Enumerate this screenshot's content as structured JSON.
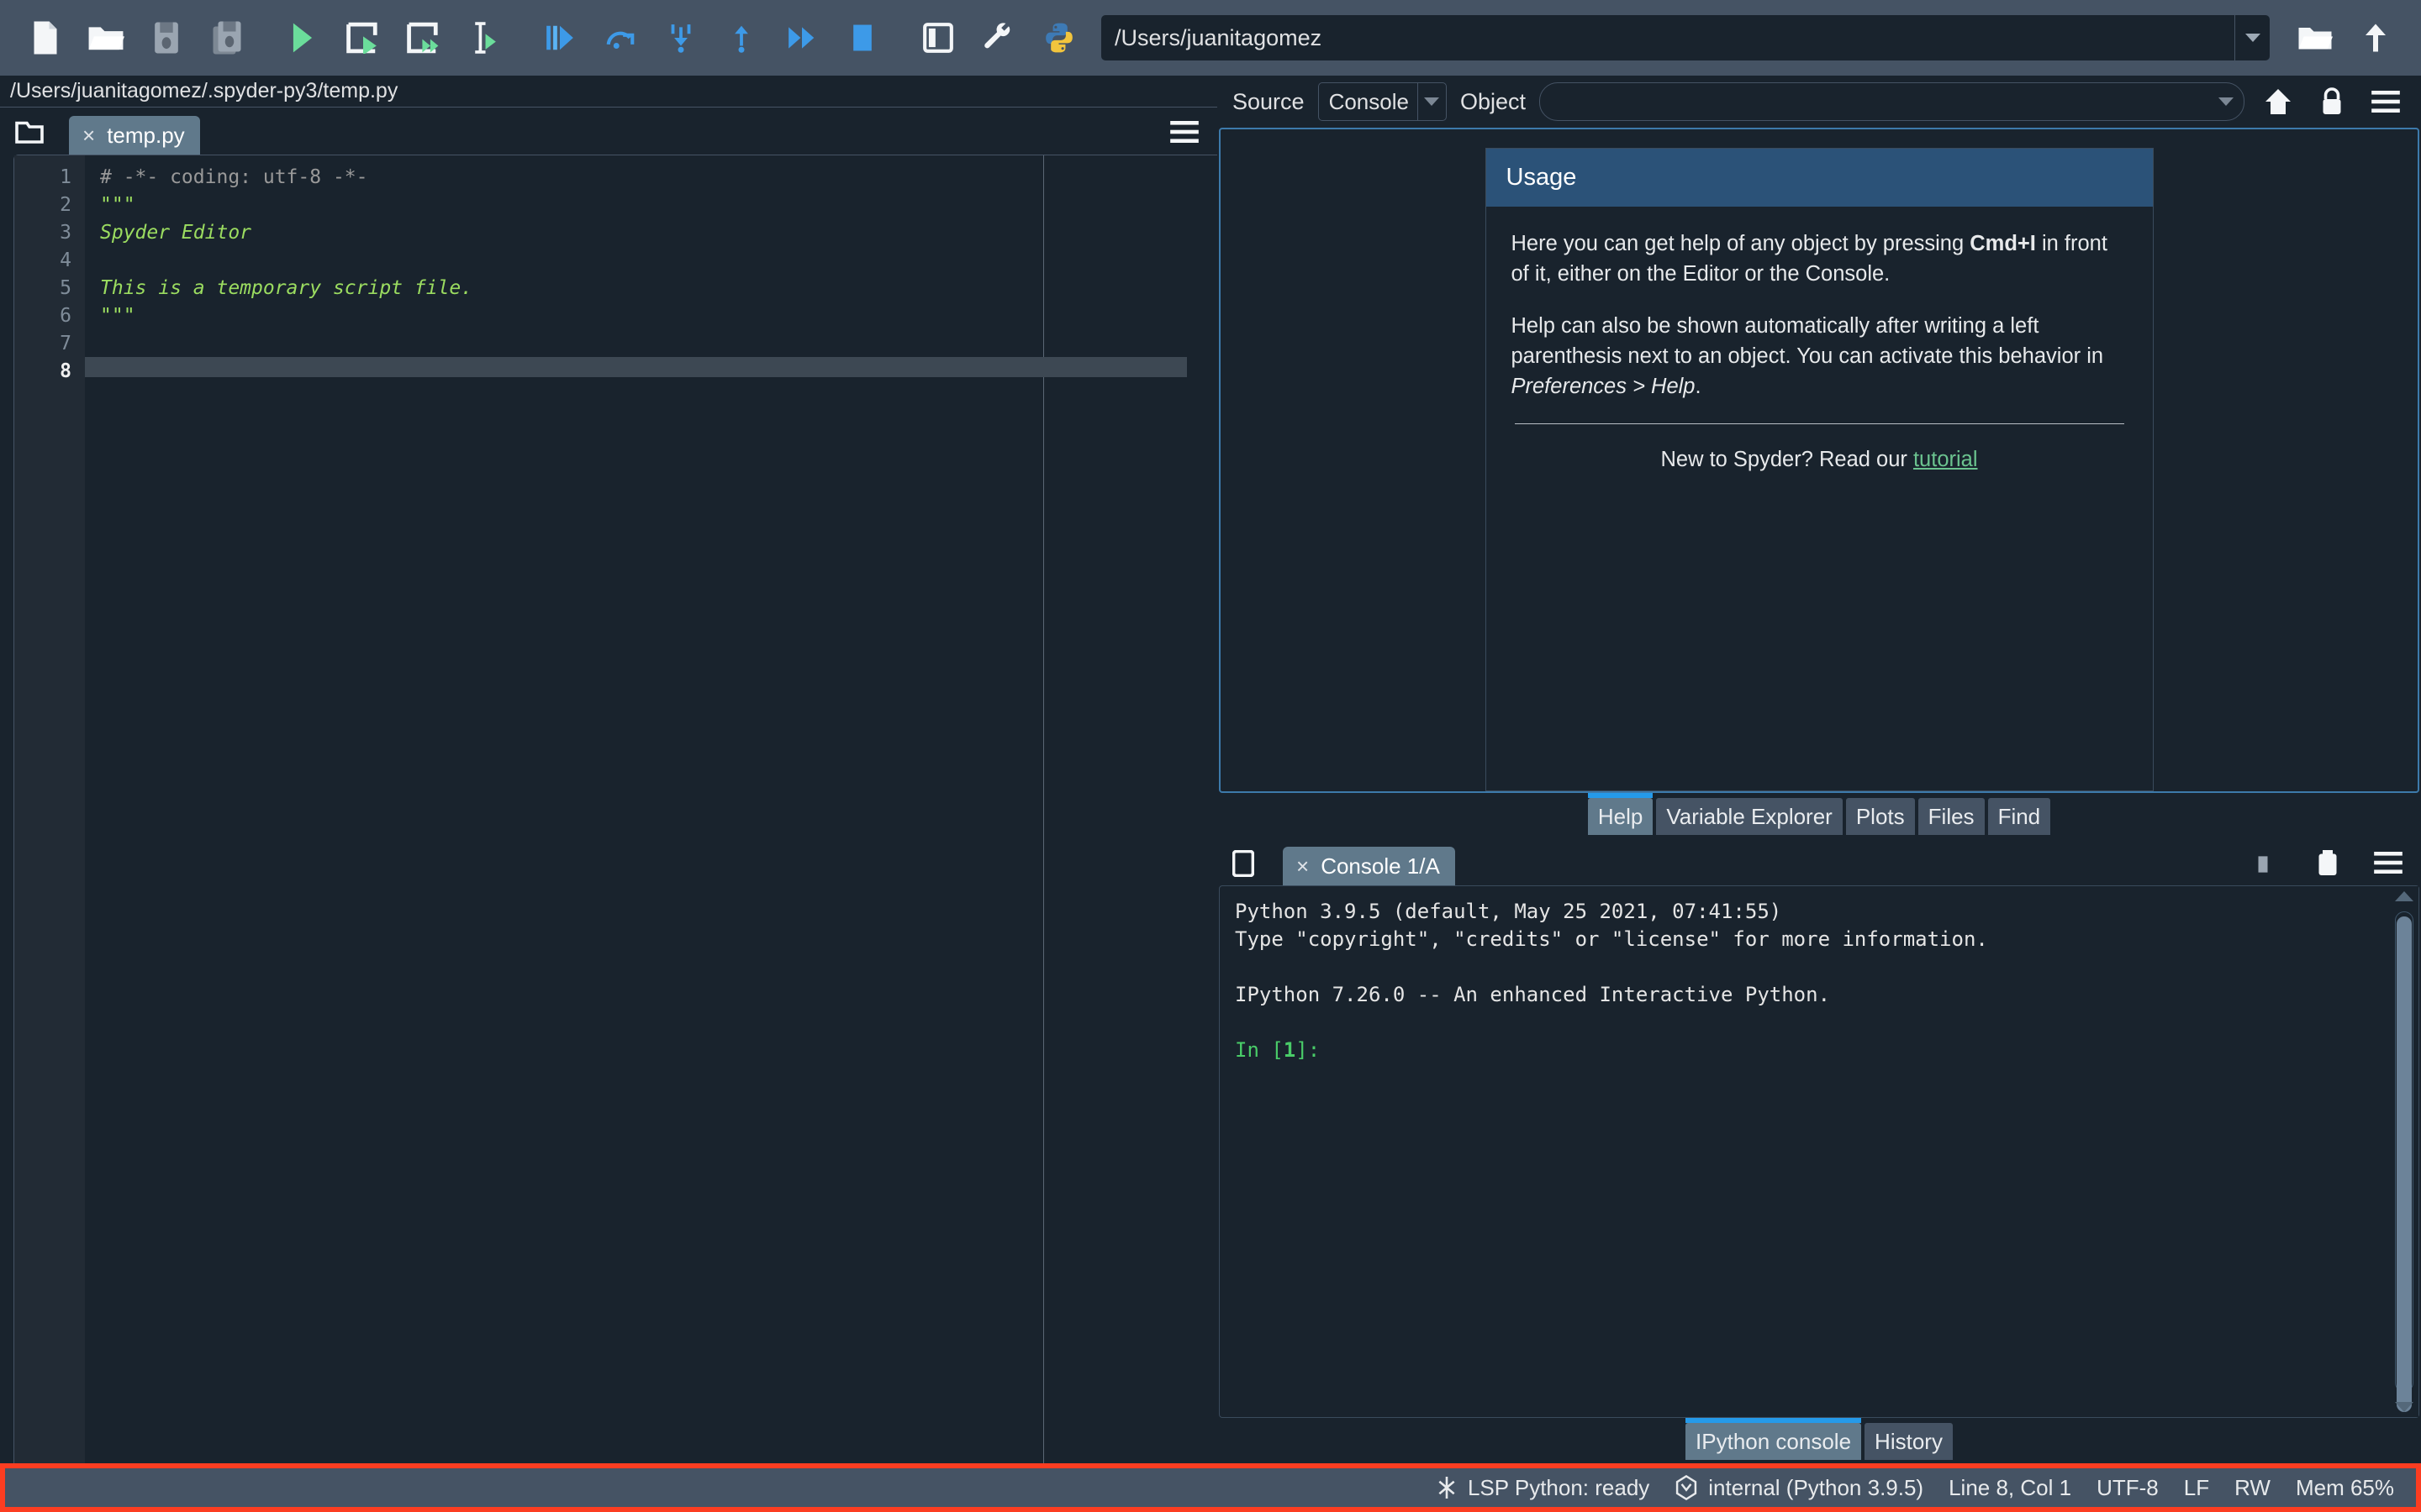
{
  "toolbar": {
    "buttons": [
      {
        "name": "new-file",
        "icon": "new-file-icon"
      },
      {
        "name": "open-file",
        "icon": "open-folder-icon"
      },
      {
        "name": "save-file",
        "icon": "save-icon"
      },
      {
        "name": "save-all",
        "icon": "save-all-icon"
      },
      {
        "name": "run-file",
        "icon": "run-icon"
      },
      {
        "name": "run-cell",
        "icon": "run-cell-icon"
      },
      {
        "name": "run-cell-advance",
        "icon": "run-cell-advance-icon"
      },
      {
        "name": "run-selection",
        "icon": "run-selection-icon"
      },
      {
        "name": "debug-file",
        "icon": "debug-icon"
      },
      {
        "name": "step-over",
        "icon": "step-over-icon"
      },
      {
        "name": "step-into",
        "icon": "step-into-icon"
      },
      {
        "name": "step-return",
        "icon": "step-return-icon"
      },
      {
        "name": "continue-execution",
        "icon": "continue-icon"
      },
      {
        "name": "stop-debugging",
        "icon": "stop-icon"
      },
      {
        "name": "maximize-pane",
        "icon": "maximize-pane-icon"
      },
      {
        "name": "preferences",
        "icon": "wrench-icon"
      },
      {
        "name": "python-path-manager",
        "icon": "python-icon"
      }
    ],
    "working_directory": "/Users/juanitagomez",
    "browse_label": "browse-folder-icon",
    "parent_label": "parent-directory-icon"
  },
  "editor": {
    "file_path": "/Users/juanitagomez/.spyder-py3/temp.py",
    "tab_label": "temp.py",
    "close_label": "×",
    "line_numbers": [
      "1",
      "2",
      "3",
      "4",
      "5",
      "6",
      "7",
      "8"
    ],
    "current_line": 8,
    "code": {
      "l1": "# -*- coding: utf-8 -*-",
      "l2": "\"\"\"",
      "l3": "Spyder Editor",
      "l4": "",
      "l5": "This is a temporary script file.",
      "l6": "\"\"\"",
      "l7": "",
      "l8": ""
    }
  },
  "help": {
    "source_label": "Source",
    "source_value": "Console",
    "object_label": "Object",
    "object_value": "",
    "home_icon": "home-icon",
    "lock_icon": "lock-icon",
    "options_icon": "hamburger-menu-icon",
    "card": {
      "title": "Usage",
      "paragraph1_pre": "Here you can get help of any object by pressing ",
      "paragraph1_kbd": "Cmd+I",
      "paragraph1_post": " in front of it, either on the Editor or the Console.",
      "paragraph2_pre": "Help can also be shown automatically after writing a left parenthesis next to an object. You can activate this behavior in ",
      "paragraph2_em": "Preferences > Help",
      "paragraph2_post": ".",
      "footer_pre": "New to Spyder? Read our ",
      "footer_link": "tutorial"
    },
    "tabs": [
      {
        "label": "Help",
        "active": true
      },
      {
        "label": "Variable Explorer",
        "active": false
      },
      {
        "label": "Plots",
        "active": false
      },
      {
        "label": "Files",
        "active": false
      },
      {
        "label": "Find",
        "active": false
      }
    ]
  },
  "console": {
    "tab_label": "Console 1/A",
    "close_label": "×",
    "browse_icon": "browse-tabs-icon",
    "interrupt_icon": "stop-square-icon",
    "remove_icon": "trash-icon",
    "options_icon": "hamburger-menu-icon",
    "output": {
      "line1": "Python 3.9.5 (default, May 25 2021, 07:41:55)",
      "line2": "Type \"copyright\", \"credits\" or \"license\" for more information.",
      "line3": "",
      "line4": "IPython 7.26.0 -- An enhanced Interactive Python.",
      "line5": "",
      "prompt_prefix": "In [",
      "prompt_num": "1",
      "prompt_suffix": "]:"
    },
    "tabs": [
      {
        "label": "IPython console",
        "active": true
      },
      {
        "label": "History",
        "active": false
      }
    ]
  },
  "statusbar": {
    "lsp_icon": "code-branch-icon",
    "lsp_status": "LSP Python: ready",
    "interpreter_icon": "python-env-icon",
    "interpreter": "internal (Python 3.9.5)",
    "cursor_position": "Line 8, Col 1",
    "encoding": "UTF-8",
    "eol": "LF",
    "permissions": "RW",
    "memory": "Mem 65%",
    "highlight_color": "#fc3d21"
  },
  "colors": {
    "toolbar_bg": "#455364",
    "pane_bg": "#19232d",
    "accent": "#259ae9",
    "tab_active": "#60798b",
    "help_header": "#2b5278",
    "link_green": "#6bc38f",
    "string_green": "#9bdc60"
  }
}
